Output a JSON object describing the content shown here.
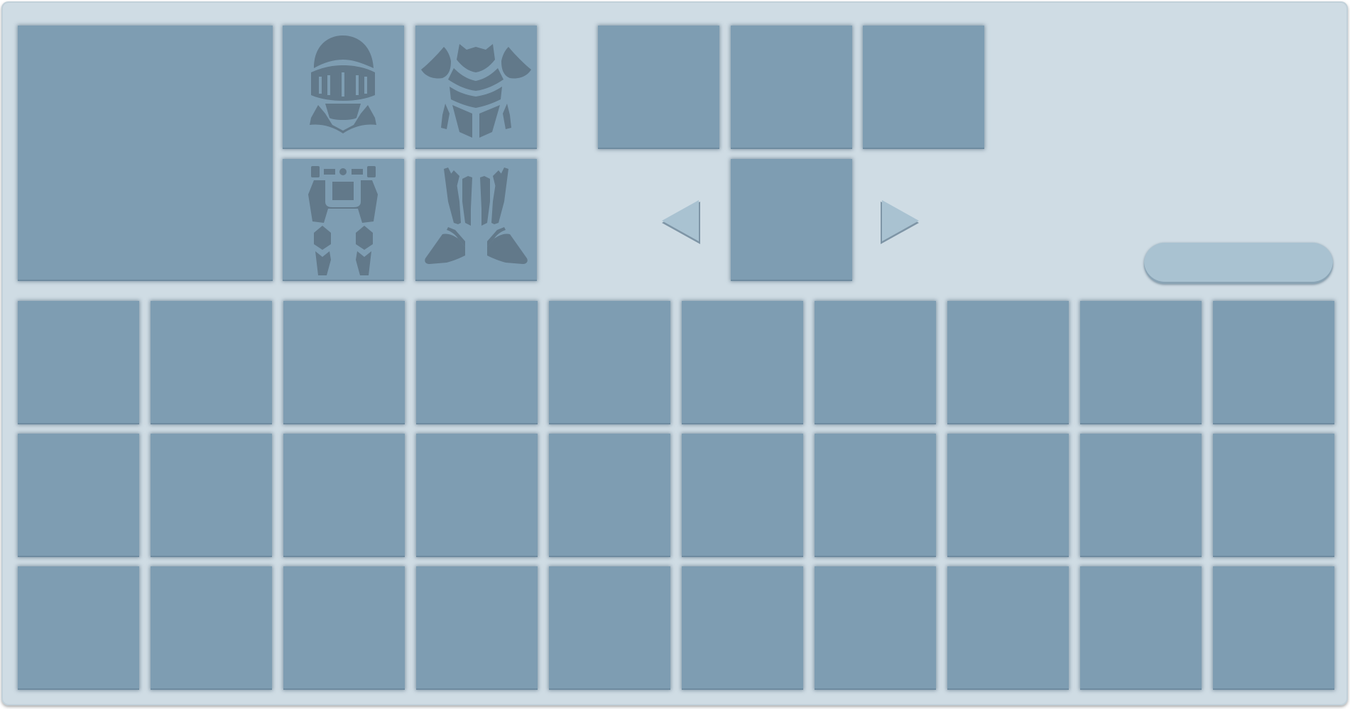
{
  "inventory": {
    "equipment": {
      "slots": [
        {
          "slot": "helmet",
          "icon": "helmet-icon"
        },
        {
          "slot": "chestplate",
          "icon": "chestplate-icon"
        },
        {
          "slot": "leggings",
          "icon": "leggings-icon"
        },
        {
          "slot": "boots",
          "icon": "boots-icon"
        }
      ]
    },
    "navigation": {
      "prev": "arrow-left-icon",
      "next": "arrow-right-icon"
    },
    "rename_field": {
      "value": ""
    },
    "grid": {
      "rows": 3,
      "columns": 10
    },
    "colors": {
      "panel": "#cfdce4",
      "slot": "#7e9db2",
      "icon": "#62798a",
      "arrow": "#a9c2d1"
    }
  }
}
